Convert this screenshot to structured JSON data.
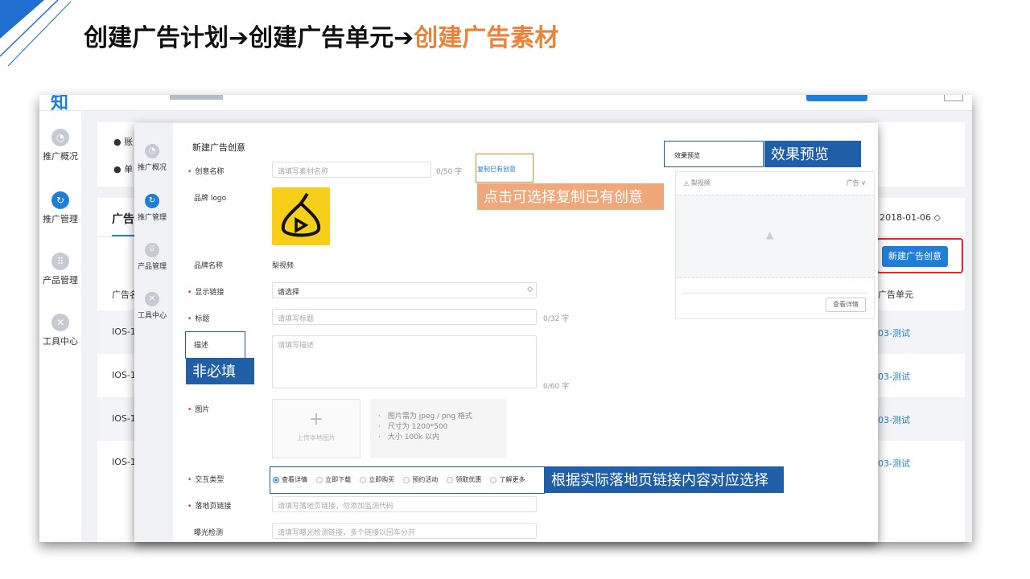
{
  "slide": {
    "title_part1": "创建广告计划➔创建广告单元➔",
    "title_part2": "创建广告素材",
    "accent_color": "#e8833a"
  },
  "bg_app": {
    "logo": "知",
    "sidebar": [
      {
        "label": "推广概况",
        "icon": "chart-icon"
      },
      {
        "label": "推广管理",
        "icon": "refresh-icon"
      },
      {
        "label": "产品管理",
        "icon": "grid-icon"
      },
      {
        "label": "工具中心",
        "icon": "wrench-icon"
      }
    ],
    "info_items": [
      "账",
      "单"
    ],
    "tab_label": "广告",
    "date_range": "~ 2018-01-06 ◇",
    "col_name": "广告名",
    "col_unit": "广告单元",
    "rows": [
      {
        "name": "IOS-1",
        "unit": "03-测试"
      },
      {
        "name": "IOS-1",
        "unit": "03-测试"
      },
      {
        "name": "IOS-1",
        "unit": "03-测试"
      },
      {
        "name": "IOS-1",
        "unit": "03-测试"
      }
    ],
    "new_button": "新建广告创意"
  },
  "fg_app": {
    "sidebar": [
      {
        "label": "推广概况",
        "icon": "chart-icon"
      },
      {
        "label": "推广管理",
        "icon": "refresh-icon"
      },
      {
        "label": "产品管理",
        "icon": "grid-icon"
      },
      {
        "label": "工具中心",
        "icon": "wrench-icon"
      }
    ],
    "form_title": "新建广告创意",
    "creative_name": {
      "label": "创意名称",
      "placeholder": "请填写素材名称",
      "counter": "0/50 字"
    },
    "copy_link": "复制已有创意",
    "brand_logo": {
      "label": "品牌 logo"
    },
    "brand_name": {
      "label": "品牌名称",
      "value": "梨视频"
    },
    "display_link": {
      "label": "显示链接",
      "value": "请选择",
      "arrow": "◇"
    },
    "headline": {
      "label": "标题",
      "placeholder": "请填写标题",
      "counter": "0/32 字"
    },
    "description": {
      "label": "描述",
      "placeholder": "请填写描述",
      "counter": "0/60 字"
    },
    "image": {
      "label": "图片",
      "upload_text": "上传本地图片",
      "tips": [
        "·　图片需为 jpeg / png 格式",
        "·　尺寸为 1200*500",
        "·　大小 100k 以内"
      ]
    },
    "interaction": {
      "label": "交互类型",
      "options": [
        "查看详情",
        "立即下载",
        "立即购买",
        "预约活动",
        "领取优惠",
        "了解更多"
      ],
      "selected": "查看详情"
    },
    "landing_url": {
      "label": "落地页链接",
      "placeholder": "请填写落地页链接，勿添加监测代码"
    },
    "impression_track": {
      "label": "曝光检测",
      "placeholder": "请填写曝光检测链接，多个链接以回车分开"
    },
    "preview": {
      "label": "效果预览",
      "app_name": "梨视频",
      "ad_tag": "广告 ∨",
      "view_btn": "查看详情"
    }
  },
  "callouts": {
    "preview": "效果预览",
    "copy": "点击可选择复制已有创意",
    "optional": "非必填",
    "interaction": "根据实际落地页链接内容对应选择"
  },
  "colors": {
    "primary": "#1f7fd6",
    "callout_blue": "#1f5fa8",
    "callout_orange": "#f0a77a",
    "highlight_red": "#e02a2a"
  }
}
